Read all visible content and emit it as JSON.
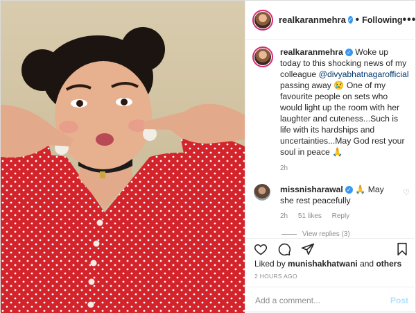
{
  "header": {
    "username": "realkaranmehra",
    "separator": "•",
    "follow_label": "Following",
    "more_label": "•••"
  },
  "caption": {
    "username": "realkaranmehra",
    "text_1": "Woke up today to this shocking news of my colleague",
    "mention": "@divyabhatnagarofficial",
    "text_2": "passing away",
    "emoji_1": "😢",
    "text_3": "One of my favourite people on sets who would light up the room with her laughter and cuteness...Such is life with its hardships and uncertainties...May God rest your soul in peace",
    "emoji_2": "🙏",
    "time": "2h"
  },
  "comment": {
    "username": "missnisharawal",
    "text": "May she rest peacefully",
    "emoji": "🙏",
    "time": "2h",
    "likes": "51 likes",
    "reply_label": "Reply",
    "view_replies": "View replies (3)"
  },
  "likes": {
    "prefix": "Liked by",
    "user": "munishakhatwani",
    "and": "and",
    "others": "others"
  },
  "timestamp": "2 HOURS AGO",
  "add_comment": {
    "placeholder": "Add a comment...",
    "post_label": "Post"
  },
  "colors": {
    "verified": "#3897f0",
    "post_disabled": "#b2dffc",
    "dress_red": "#d3242c",
    "background_beige": "#cfc19f"
  },
  "icons": [
    "heart-icon",
    "comment-icon",
    "share-icon",
    "bookmark-icon",
    "verified-icon",
    "more-icon"
  ]
}
